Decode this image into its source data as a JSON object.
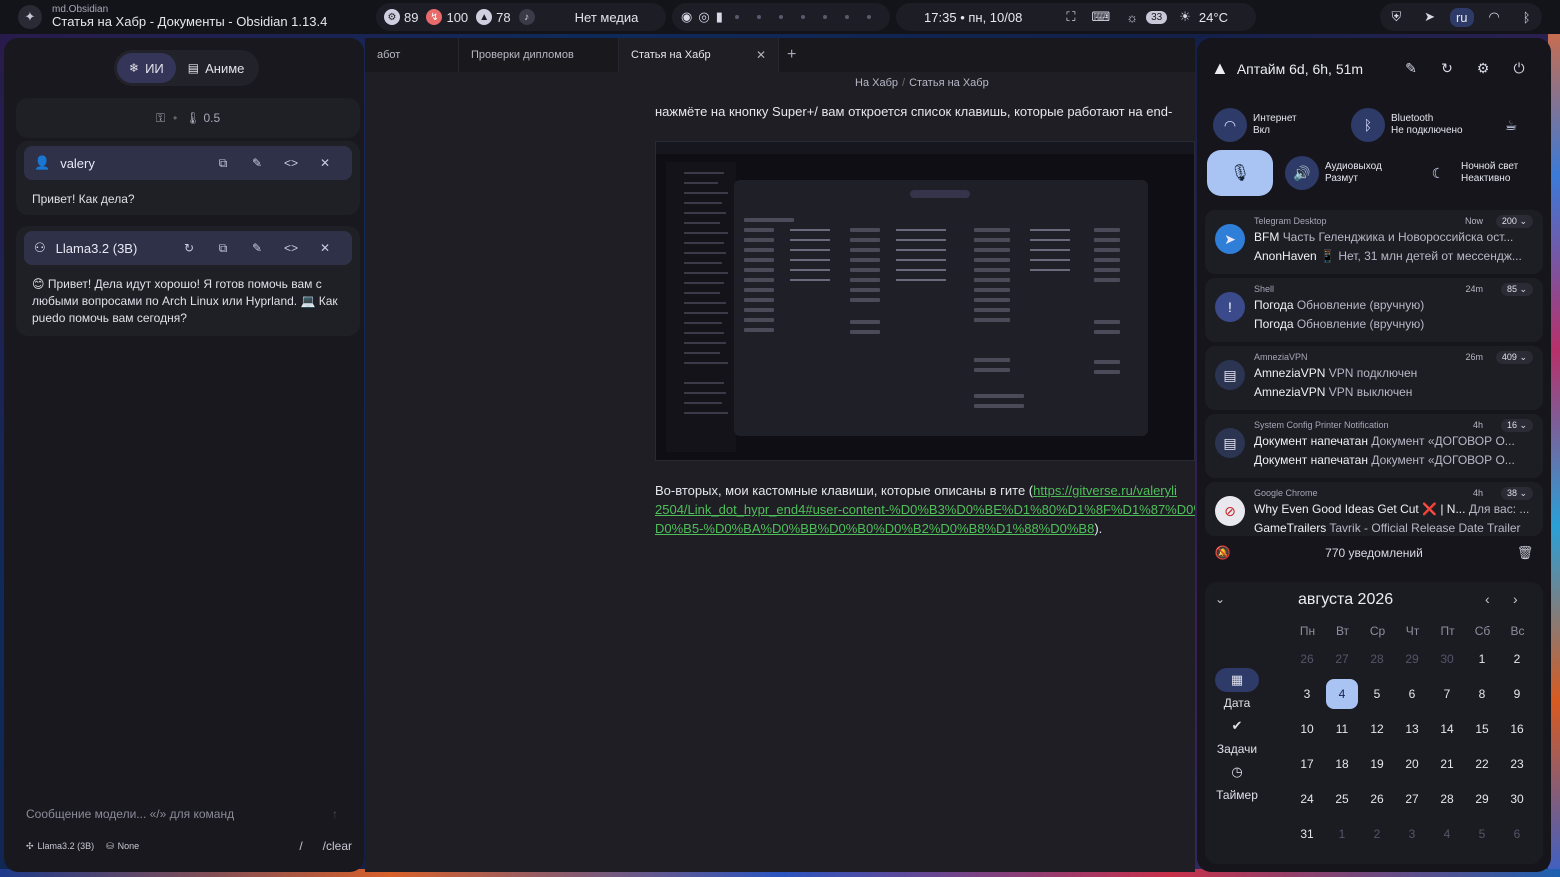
{
  "topbar": {
    "app_class": "md.Obsidian",
    "window_title": "Статья на Хабр - Документы - Obsidian 1.13.4",
    "cpu": "89",
    "battery": "100",
    "ram": "78",
    "media": "Нет медиа",
    "clock": "17:35 • пн, 10/08",
    "brightness": "33",
    "weather": "24°C",
    "lang": "ru"
  },
  "left_panel": {
    "tabs": [
      {
        "label": "ИИ",
        "icon": "snowflake-icon"
      },
      {
        "label": "Аниме",
        "icon": "book-icon"
      }
    ],
    "temperature": "0.5",
    "user_name": "valery",
    "user_message": "Привет! Как дела?",
    "model_name": "Llama3.2 (3B)",
    "model_message": "😊 Привет! Дела идут хорошо! Я готов помочь вам с любыми вопросами по Arch Linux или Hyprland. 💻 Как puedo помочь вам сегодня?",
    "input_placeholder": "Сообщение модели... «/» для команд",
    "footer_model": "Llama3.2 (3B)",
    "footer_tool": "None",
    "footer_slash": "/",
    "footer_clear": "/clear"
  },
  "editor": {
    "tabs": [
      "абот",
      "Проверки дипломов",
      "Статья на Хабр"
    ],
    "breadcrumb": [
      "На Хабр",
      "Статья на Хабр"
    ],
    "line1": "нажмёте на кнопку Super+/ вам откроется список клавишь, которые работают на end-",
    "para2_text": "Во-вторых, мои кастомные клавиши, которые описаны в гите (",
    "para2_link1": "https://gitverse.ru/valeryli",
    "para2_link2": "2504/Link_dot_hypr_end4#user-content-%D0%B3%D0%BE%D1%80%D1%8F%D1%87%D0%",
    "para2_link3": "D0%B5-%D0%BA%D0%BB%D0%B0%D0%B2%D0%B8%D1%88%D0%B8",
    "para2_end": ")."
  },
  "right_panel": {
    "uptime": "Аптайм 6d, 6h, 51m",
    "quick_settings": [
      {
        "title": "Интернет",
        "sub": "Вкл",
        "icon": "wifi-icon"
      },
      {
        "title": "Bluetooth",
        "sub": "Не подключено",
        "icon": "bluetooth-icon"
      },
      {
        "title": "Аудиовыход",
        "sub": "Размут",
        "icon": "speaker-icon"
      },
      {
        "title": "Ночной свет",
        "sub": "Неактивно",
        "icon": "moon-icon"
      }
    ],
    "notifications": [
      {
        "app": "Telegram Desktop",
        "time": "Now",
        "count": "200",
        "icon": "telegram-icon",
        "l1_title": "BFM",
        "l1_body": "Часть Геленджика и Новороссийска ост...",
        "l2_title": "AnonHaven",
        "l2_body": "📱 Нет, 31 млн детей от мессендж..."
      },
      {
        "app": "Shell",
        "time": "24m",
        "count": "85",
        "icon": "alert-icon",
        "l1_title": "Погода",
        "l1_body": "Обновление (вручную)",
        "l2_title": "Погода",
        "l2_body": "Обновление (вручную)"
      },
      {
        "app": "AmneziaVPN",
        "time": "26m",
        "count": "409",
        "icon": "message-icon",
        "l1_title": "AmneziaVPN",
        "l1_body": "VPN подключен",
        "l2_title": "AmneziaVPN",
        "l2_body": "VPN выключен"
      },
      {
        "app": "System Config Printer Notification",
        "time": "4h",
        "count": "16",
        "icon": "message-icon",
        "l1_title": "Документ напечатан",
        "l1_body": "Документ «ДОГОВОР О...",
        "l2_title": "Документ напечатан",
        "l2_body": "Документ «ДОГОВОР О..."
      },
      {
        "app": "Google Chrome",
        "time": "4h",
        "count": "38",
        "icon": "blocked-icon",
        "l1_title": "Why Even Good Ideas Get Cut ❌ | N...",
        "l1_body": "Для вас: ...",
        "l2_title": "GameTrailers",
        "l2_body": "Tavrik - Official Release Date Trailer"
      }
    ],
    "notif_count": "770 уведомлений",
    "calendar": {
      "month": "августа 2026",
      "weekdays": [
        "Пн",
        "Вт",
        "Ср",
        "Чт",
        "Пт",
        "Сб",
        "Вс"
      ],
      "days": [
        "26",
        "27",
        "28",
        "29",
        "30",
        "1",
        "2",
        "3",
        "4",
        "5",
        "6",
        "7",
        "8",
        "9",
        "10",
        "11",
        "12",
        "13",
        "14",
        "15",
        "16",
        "17",
        "18",
        "19",
        "20",
        "21",
        "22",
        "23",
        "24",
        "25",
        "26",
        "27",
        "28",
        "29",
        "30",
        "31",
        "1",
        "2",
        "3",
        "4",
        "5",
        "6"
      ],
      "today_index": 8,
      "side": [
        {
          "label": "Дата",
          "icon": "calendar-icon"
        },
        {
          "label": "Задачи",
          "icon": "check-icon"
        },
        {
          "label": "Таймер",
          "icon": "timer-icon"
        }
      ]
    }
  }
}
